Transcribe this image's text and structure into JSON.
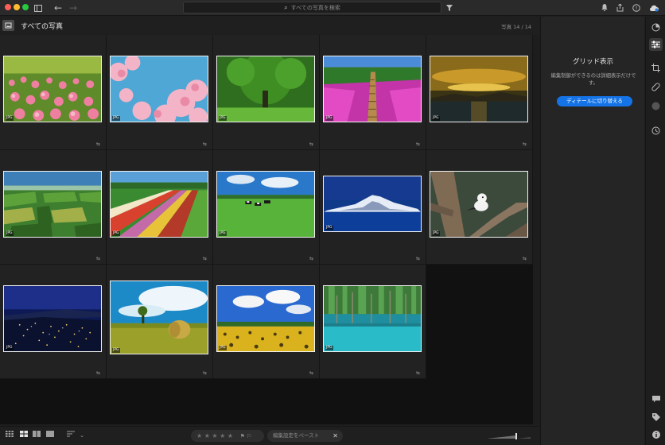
{
  "titlebar": {
    "search_placeholder": "すべての写真を検索",
    "icons": [
      "sidebar-toggle-icon",
      "back-arrow-icon",
      "forward-arrow-icon",
      "filter-icon",
      "bell-icon",
      "share-icon",
      "help-icon",
      "cloud-icon"
    ]
  },
  "header": {
    "title": "すべての写真",
    "count": "写真 14 / 14"
  },
  "photos": [
    {
      "badge": "JPG"
    },
    {
      "badge": "JPG"
    },
    {
      "badge": "JPG"
    },
    {
      "badge": "JPG"
    },
    {
      "badge": "JPG"
    },
    {
      "badge": "JPG"
    },
    {
      "badge": "JPG"
    },
    {
      "badge": "JPG"
    },
    {
      "badge": "JPG"
    },
    {
      "badge": "JPG"
    },
    {
      "badge": "JPG"
    },
    {
      "badge": "JPG"
    },
    {
      "badge": "JPG"
    },
    {
      "badge": "JPG"
    }
  ],
  "right_panel": {
    "title": "グリッド表示",
    "description": "編集制御ができるのは詳細表示だけです。",
    "button": "ディテールに切り替える"
  },
  "bottombar": {
    "stars": "★ ★ ★ ★ ★",
    "flags": "⚑ ⚐",
    "paste_label": "編集設定をペースト",
    "close": "✕"
  },
  "colors": {
    "accent": "#1473e6",
    "panel": "#252525",
    "grid_bg": "#111111"
  }
}
